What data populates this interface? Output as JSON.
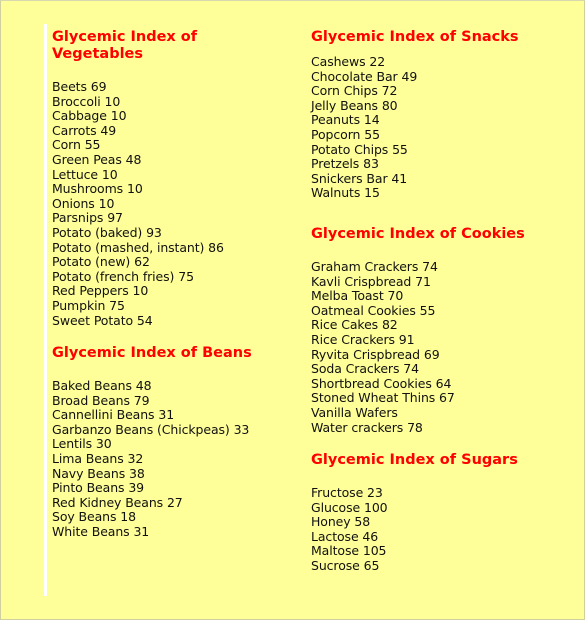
{
  "colors": {
    "background": "#ffff99",
    "heading": "#ff0000",
    "text": "#111111",
    "rule": "#ffffff"
  },
  "sections": {
    "vegetables": {
      "title": "Glycemic Index of Vegetables",
      "items": [
        "Beets 69",
        "Broccoli 10",
        "Cabbage 10",
        "Carrots 49",
        "Corn 55",
        "Green Peas 48",
        "Lettuce 10",
        "Mushrooms 10",
        "Onions 10",
        "Parsnips 97",
        "Potato (baked) 93",
        "Potato (mashed, instant) 86",
        "Potato (new) 62",
        "Potato (french fries) 75",
        "Red Peppers 10",
        "Pumpkin 75",
        "Sweet Potato 54"
      ]
    },
    "beans": {
      "title": "Glycemic Index of Beans",
      "items": [
        "Baked Beans 48",
        "Broad Beans 79",
        "Cannellini Beans 31",
        "Garbanzo Beans (Chickpeas) 33",
        "Lentils 30",
        "Lima Beans 32",
        "Navy Beans 38",
        "Pinto Beans 39",
        "Red Kidney Beans 27",
        "Soy Beans 18",
        "White Beans 31"
      ]
    },
    "snacks": {
      "title": "Glycemic Index of Snacks",
      "items": [
        "Cashews 22",
        "Chocolate Bar 49",
        "Corn Chips 72",
        "Jelly Beans 80",
        "Peanuts 14",
        "Popcorn 55",
        "Potato Chips 55",
        "Pretzels 83",
        "Snickers Bar 41",
        "Walnuts 15"
      ]
    },
    "cookies": {
      "title": "Glycemic Index of Cookies",
      "items": [
        "Graham Crackers 74",
        "Kavli Crispbread 71",
        "Melba Toast 70",
        "Oatmeal Cookies 55",
        "Rice Cakes 82",
        "Rice Crackers 91",
        "Ryvita Crispbread 69",
        "Soda Crackers 74",
        "Shortbread Cookies 64",
        "Stoned Wheat Thins 67",
        "Vanilla Wafers",
        "Water crackers 78"
      ]
    },
    "sugars": {
      "title": "Glycemic Index of Sugars",
      "items": [
        "Fructose 23",
        "Glucose 100",
        "Honey 58",
        "Lactose 46",
        "Maltose 105",
        "Sucrose 65"
      ]
    }
  }
}
